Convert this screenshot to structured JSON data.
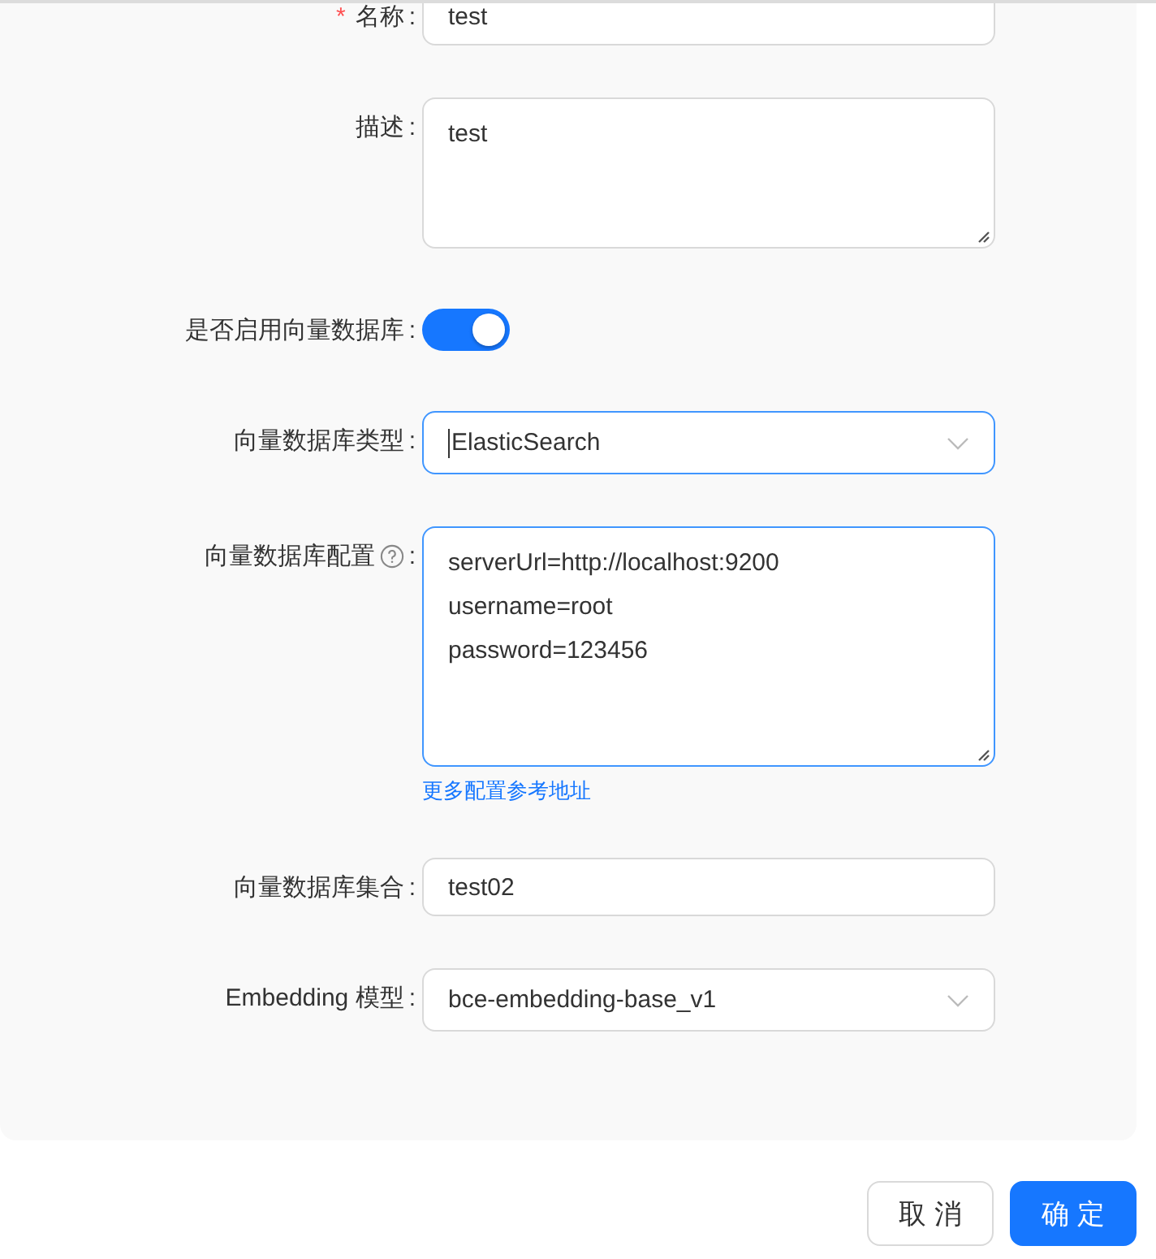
{
  "form": {
    "fields": [
      {
        "kind": "input",
        "required_mark": "*",
        "label": "名称",
        "colon": ":",
        "value": "test",
        "focused": false
      },
      {
        "kind": "textarea",
        "label": "描述",
        "colon": ":",
        "lines": [
          "test"
        ],
        "focused": false
      },
      {
        "kind": "switch",
        "label": "是否启用向量数据库",
        "colon": ":",
        "on": true
      },
      {
        "kind": "select",
        "label": "向量数据库类型",
        "colon": ":",
        "value": "ElasticSearch",
        "focused": true
      },
      {
        "kind": "textarea",
        "label": "向量数据库配置",
        "help": true,
        "colon": ":",
        "lines": [
          "serverUrl=http://localhost:9200",
          "username=root",
          "password=123456"
        ],
        "focused": true,
        "link": "更多配置参考地址"
      },
      {
        "kind": "input",
        "label": "向量数据库集合",
        "colon": ":",
        "value": "test02",
        "focused": false
      },
      {
        "kind": "select",
        "label": "Embedding 模型",
        "colon": ":",
        "value": "bce-embedding-base_v1",
        "focused": false
      }
    ]
  },
  "footer": {
    "buttons": [
      {
        "label": "取 消",
        "kind": "default"
      },
      {
        "label": "确 定",
        "kind": "primary"
      }
    ]
  }
}
